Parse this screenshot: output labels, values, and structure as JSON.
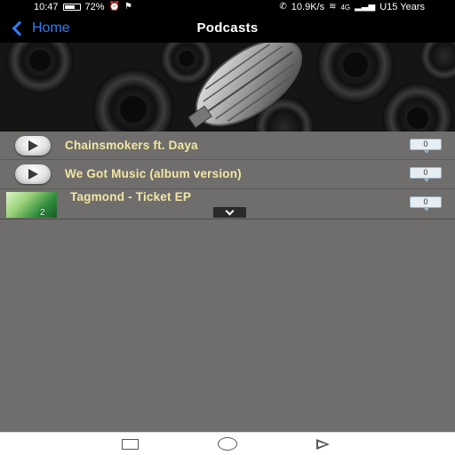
{
  "status_bar": {
    "time": "10:47",
    "battery": "72%",
    "network_speed": "10.9K/s",
    "network_type": "4G",
    "carrier": "U15 Years"
  },
  "header": {
    "back_label": "Home",
    "title": "Podcasts"
  },
  "tracks": [
    {
      "title": "Chainsmokers ft. Daya",
      "comments": "0"
    },
    {
      "title": "We Got Music (album version)",
      "comments": "0"
    },
    {
      "title": "Tagmond - Ticket EP",
      "comments": "0",
      "thumb_label": "2"
    }
  ],
  "icons": {
    "back": "chevron-left-icon",
    "play": "play-icon",
    "comment": "comment-bubble-icon",
    "expand": "chevron-down-icon",
    "nav_back": "square-icon",
    "nav_home": "circle-icon",
    "nav_recent": "triangle-icon"
  },
  "colors": {
    "accent": "#2f7cf2",
    "track_title": "#f3e7a4",
    "list_background": "#6f6e6c"
  }
}
